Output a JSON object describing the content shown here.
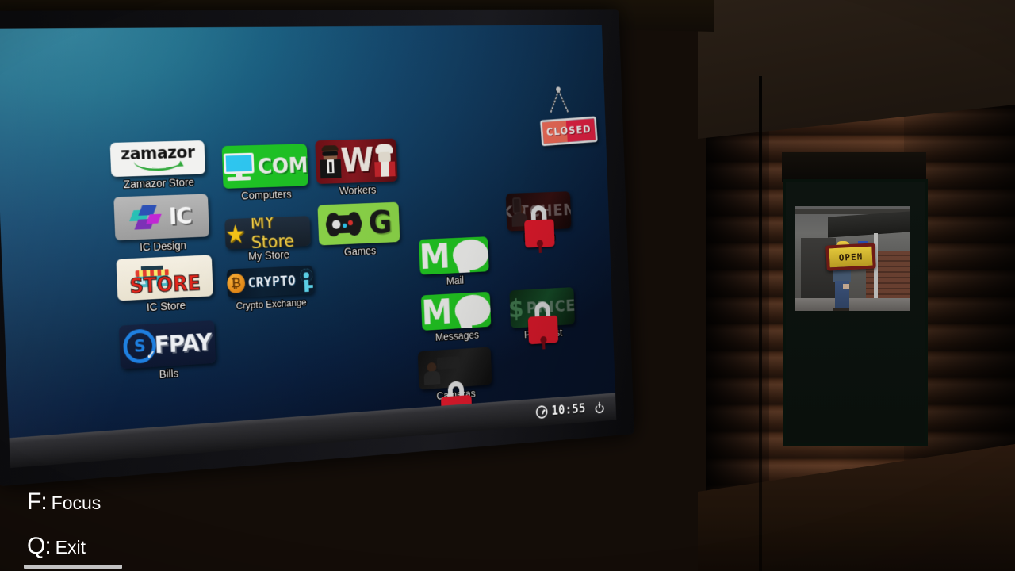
{
  "hud": {
    "focus_key": "F:",
    "focus_action": "Focus",
    "exit_key": "Q:",
    "exit_action": "Exit"
  },
  "desktop": {
    "background_colors": [
      "#2a7c96",
      "#15486e",
      "#08152e"
    ],
    "closed_sign": {
      "label": "CLOSED",
      "colors": {
        "left": "#f9705c",
        "right": "#ef2347",
        "border": "#f4f4f4"
      }
    },
    "icons": [
      {
        "id": "zamazor-store",
        "label": "Zamazor Store",
        "tile_text": "zamazor",
        "locked": false,
        "column": 1,
        "accent": "#2fa83a"
      },
      {
        "id": "ic-design",
        "label": "IC Design",
        "tile_text": "IC",
        "locked": false,
        "column": 1,
        "accent": "#b6b6b6"
      },
      {
        "id": "ic-store",
        "label": "IC Store",
        "tile_text": "STORE",
        "locked": false,
        "column": 1,
        "accent": "#e4251b"
      },
      {
        "id": "bills",
        "label": "Bills",
        "tile_text": "FPAY",
        "locked": false,
        "column": 1,
        "accent": "#1e7fe0"
      },
      {
        "id": "computers",
        "label": "Computers",
        "tile_text": "COM",
        "locked": false,
        "column": 2,
        "accent": "#1fc325"
      },
      {
        "id": "my-store",
        "label": "My Store",
        "tile_text": "MY Store",
        "locked": false,
        "column": 2,
        "accent": "#f2cf4a"
      },
      {
        "id": "crypto-exchange",
        "label": "Crypto Exchange",
        "tile_text": "CRYPTO",
        "locked": false,
        "column": 2,
        "accent": "#5fd8f0"
      },
      {
        "id": "workers",
        "label": "Workers",
        "tile_text": "W",
        "locked": false,
        "column": 3,
        "accent": "#8a1820"
      },
      {
        "id": "games",
        "label": "Games",
        "tile_text": "G",
        "locked": false,
        "column": 3,
        "accent": "#8ed94a"
      },
      {
        "id": "mail",
        "label": "Mail",
        "tile_text": "M",
        "locked": false,
        "column": 4,
        "accent": "#22c922"
      },
      {
        "id": "messages",
        "label": "Messages",
        "tile_text": "M",
        "locked": false,
        "column": 4,
        "accent": "#22c922"
      },
      {
        "id": "cameras",
        "label": "Cameras",
        "tile_text": "",
        "locked": true,
        "column": 4,
        "accent": "#ec1b2e"
      },
      {
        "id": "kitchen",
        "label": "Kitchen",
        "tile_text": "KITCHEN",
        "locked": true,
        "column": 5,
        "accent": "#ec1b2e"
      },
      {
        "id": "price-list",
        "label": "Price List",
        "tile_text": "PRICE",
        "locked": true,
        "column": 5,
        "accent": "#ec1b2e"
      }
    ],
    "taskbar": {
      "clock": "10:55",
      "clock_icon": "clock-icon",
      "power_icon": "power-icon"
    }
  },
  "room": {
    "outside_sign": "OPEN"
  }
}
